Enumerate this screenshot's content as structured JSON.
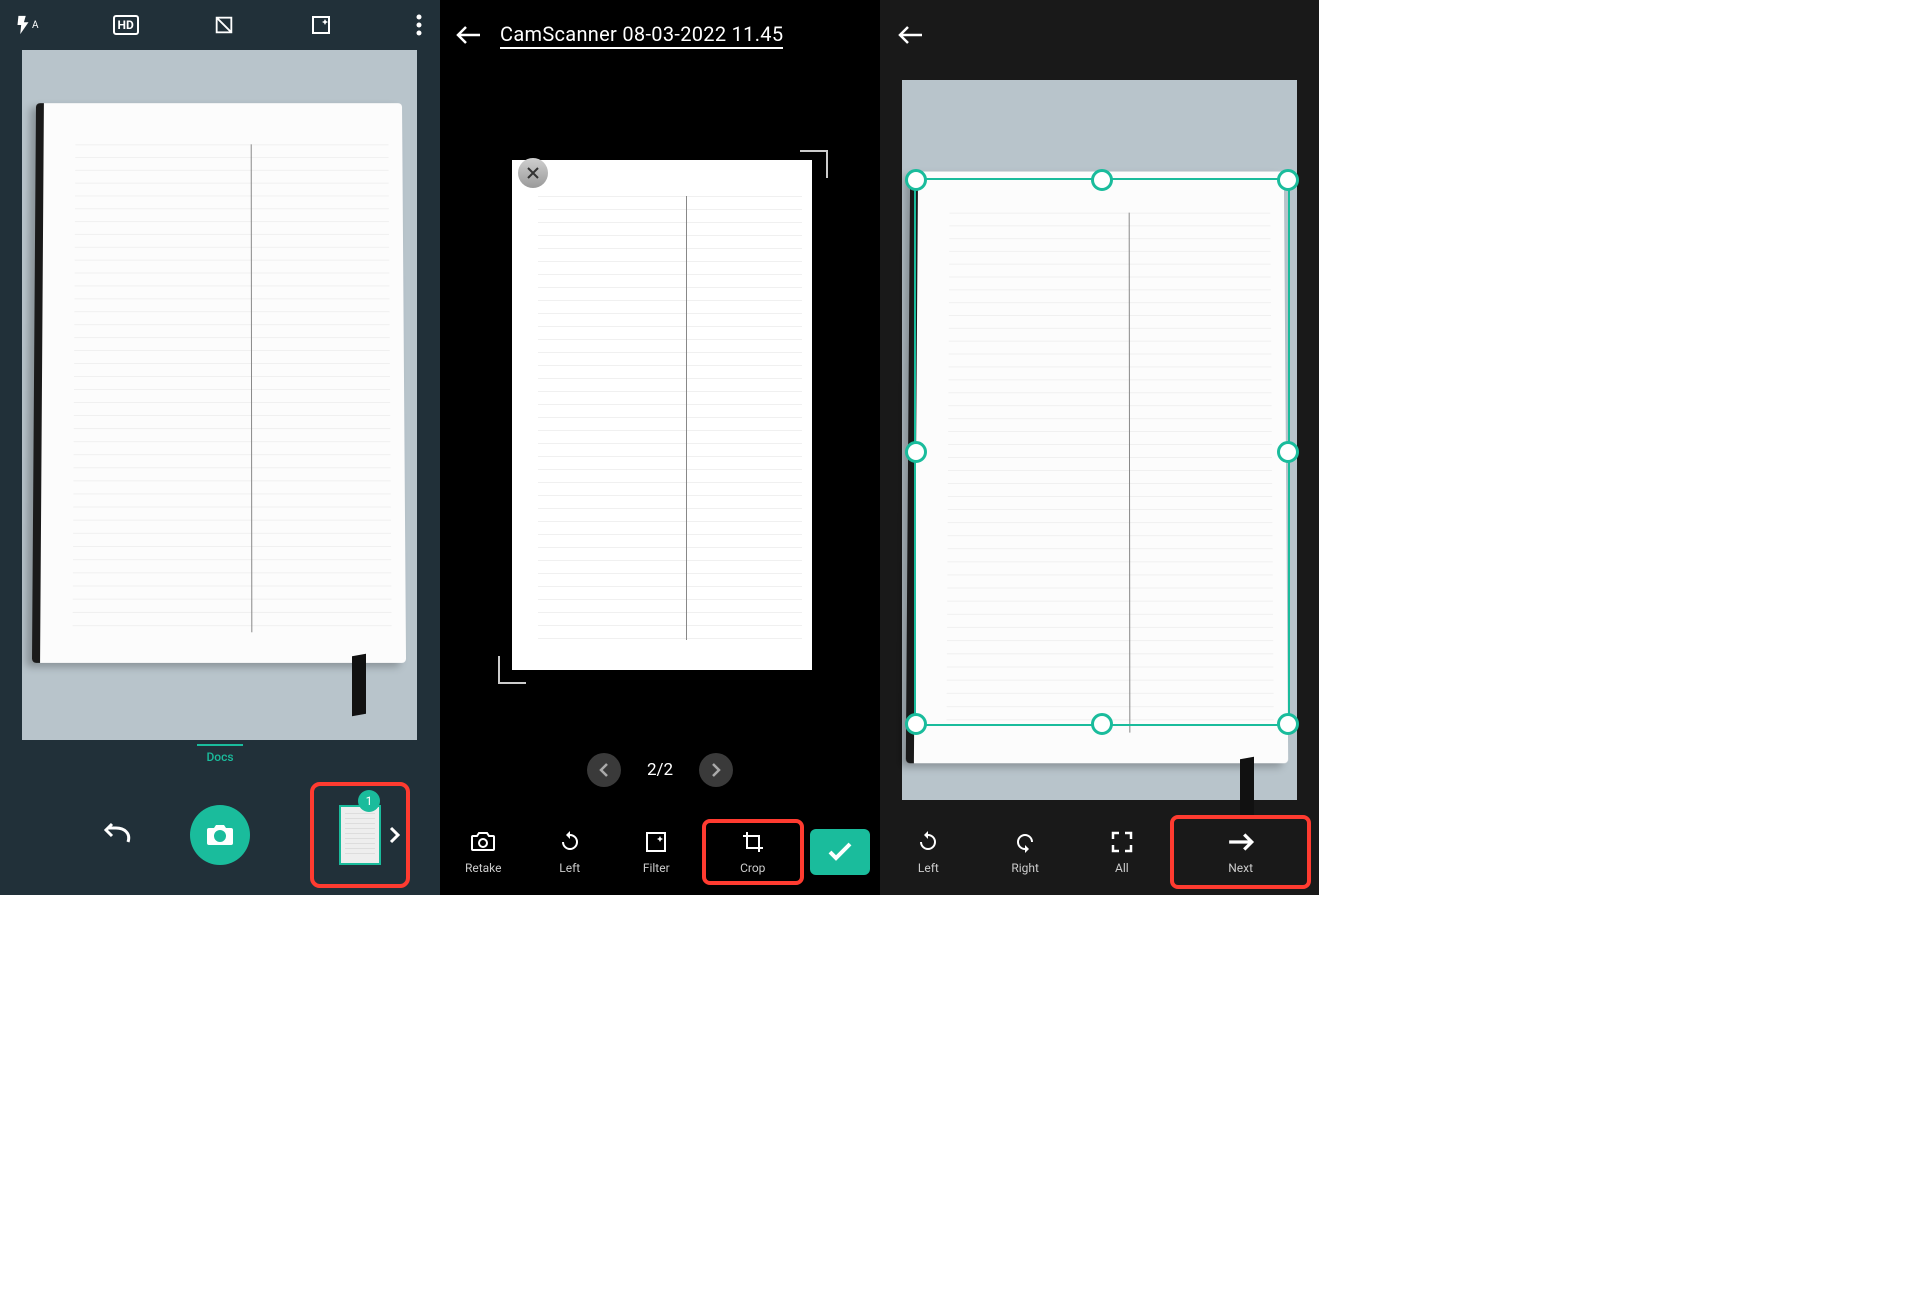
{
  "panel1": {
    "topIcons": {
      "flash": "A",
      "hd": "HD"
    },
    "modeLabel": "Docs",
    "thumbBadge": "1"
  },
  "panel2": {
    "title": "CamScanner 08-03-2022 11.45",
    "pageIndicator": "2/2",
    "tools": {
      "retake": "Retake",
      "left": "Left",
      "filter": "Filter",
      "crop": "Crop"
    }
  },
  "panel3": {
    "tools": {
      "left": "Left",
      "right": "Right",
      "all": "All",
      "next": "Next"
    }
  },
  "colors": {
    "accent": "#1abc9c",
    "highlight": "#ff3b30"
  }
}
